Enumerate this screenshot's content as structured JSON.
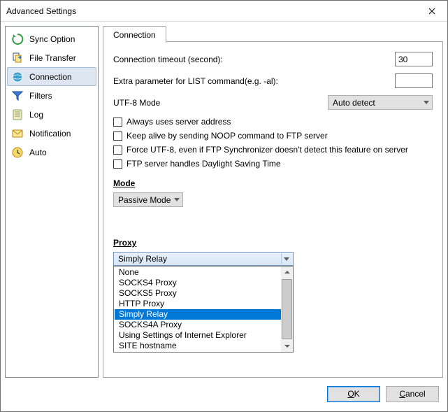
{
  "window": {
    "title": "Advanced Settings"
  },
  "sidebar": {
    "items": [
      {
        "label": "Sync Option"
      },
      {
        "label": "File Transfer"
      },
      {
        "label": "Connection"
      },
      {
        "label": "Filters"
      },
      {
        "label": "Log"
      },
      {
        "label": "Notification"
      },
      {
        "label": "Auto"
      }
    ]
  },
  "tab": {
    "label": "Connection"
  },
  "conn": {
    "timeout_label": "Connection timeout (second):",
    "timeout_value": "30",
    "list_param_label": "Extra parameter for LIST command(e.g. -al):",
    "list_param_value": "",
    "utf8_label": "UTF-8 Mode",
    "utf8_value": "Auto detect",
    "chk_server_addr": "Always uses server address",
    "chk_noop": "Keep alive by sending NOOP command to FTP server",
    "chk_force_utf8": "Force UTF-8, even if FTP Synchronizer doesn't detect this feature on server",
    "chk_dst": "FTP server handles Daylight Saving Time"
  },
  "mode": {
    "heading": "Mode",
    "value": "Passive Mode"
  },
  "proxy": {
    "heading": "Proxy",
    "value": "Simply Relay",
    "options": [
      "None",
      "SOCKS4 Proxy",
      "SOCKS5 Proxy",
      "HTTP Proxy",
      "Simply Relay",
      "SOCKS4A Proxy",
      "Using Settings of Internet Explorer",
      "SITE hostname"
    ],
    "selected_index": 4
  },
  "buttons": {
    "ok_u": "O",
    "ok_rest": "K",
    "cancel_u": "C",
    "cancel_rest": "ancel"
  },
  "colors": {
    "accent": "#0078d7",
    "sidebar_sel": "#dde6f1"
  }
}
